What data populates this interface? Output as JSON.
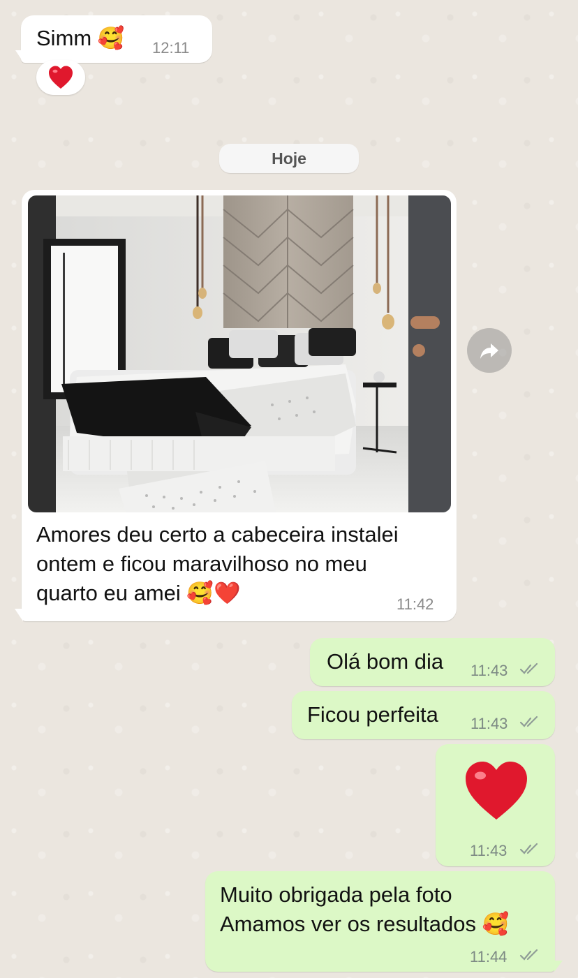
{
  "conversation": {
    "date_separator": "Hoje",
    "messages": [
      {
        "direction": "incoming",
        "text": "Simm 🥰",
        "time": "12:11",
        "reaction": "❤️"
      },
      {
        "direction": "incoming",
        "type": "image",
        "caption": "Amores deu certo a cabeceira instalei\nontem e ficou maravilhoso no meu\nquarto eu amei 🥰❤️",
        "time": "11:42",
        "image_alt_icon": "forward-icon"
      },
      {
        "direction": "outgoing",
        "text": "Olá bom dia",
        "time": "11:43",
        "status": "read"
      },
      {
        "direction": "outgoing",
        "text": "Ficou perfeita",
        "time": "11:43",
        "status": "read"
      },
      {
        "direction": "outgoing",
        "text": "❤️",
        "time": "11:43",
        "status": "read",
        "type": "emoji"
      },
      {
        "direction": "outgoing",
        "text": "Muito obrigada pela foto\nAmamos ver os resultados 🥰",
        "time": "11:44",
        "status": "read"
      }
    ]
  },
  "icons": {
    "forward": "forward-icon",
    "double_check": "double-check-icon",
    "heart": "heart-icon"
  },
  "colors": {
    "incoming_bubble": "#ffffff",
    "outgoing_bubble": "#dcf8c6",
    "read_tick": "#8f9c96",
    "wallpaper": "#ebe6df",
    "heart": "#e0182d"
  }
}
